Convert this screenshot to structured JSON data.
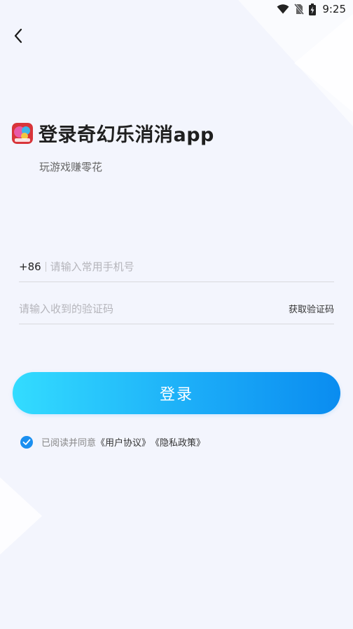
{
  "status_bar": {
    "time": "9:25",
    "icons": [
      "wifi-icon",
      "no-sim-icon",
      "battery-charging-icon"
    ]
  },
  "nav": {
    "back_icon": "chevron-left-icon"
  },
  "header": {
    "logo_icon": "app-logo-icon",
    "title": "登录奇幻乐消消app",
    "subtitle": "玩游戏赚零花"
  },
  "form": {
    "country_code": "+86",
    "phone_placeholder": "请输入常用手机号",
    "phone_value": "",
    "code_placeholder": "请输入收到的验证码",
    "code_value": "",
    "get_code_label": "获取验证码"
  },
  "login_button": {
    "label": "登录"
  },
  "agreement": {
    "checked": true,
    "prefix": "已阅读并同意",
    "user_agreement": "《用户协议》",
    "privacy_policy": "《隐私政策》"
  },
  "colors": {
    "background": "#f3f5fd",
    "button_gradient_start": "#33dcff",
    "button_gradient_end": "#0a8cf0",
    "checkbox": "#1a8ff0",
    "placeholder": "#b5b5bb"
  }
}
